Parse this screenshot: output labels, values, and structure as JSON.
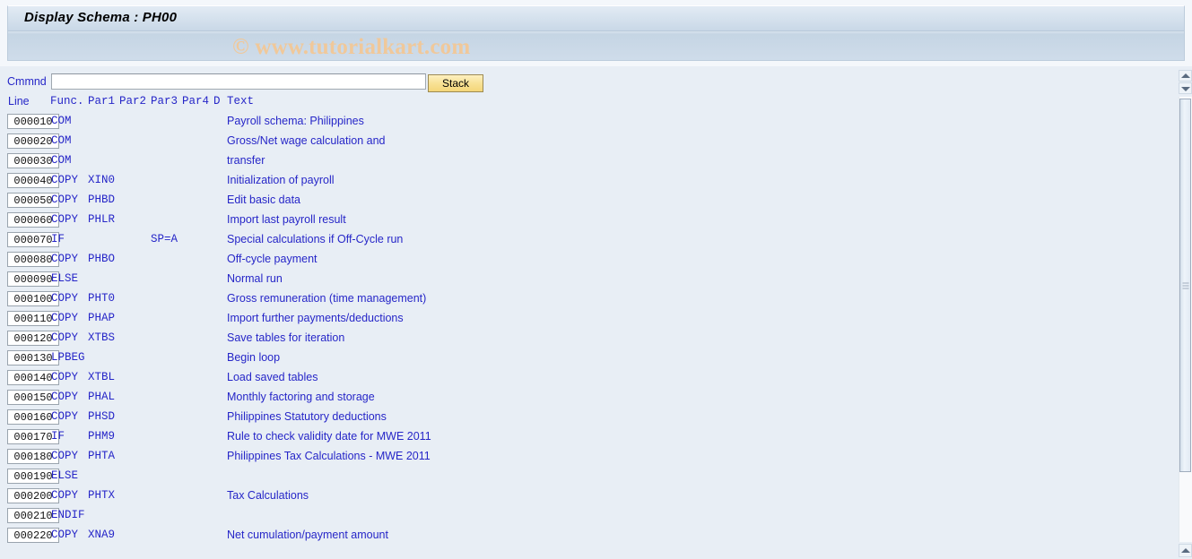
{
  "window": {
    "title": "Display Schema : PH00",
    "watermark": "© www.tutorialkart.com"
  },
  "command_bar": {
    "label": "Cmmnd",
    "value": "",
    "placeholder": "",
    "stack_label": "Stack"
  },
  "table": {
    "headers": {
      "line": "Line",
      "func": "Func.",
      "par1": "Par1",
      "par2": "Par2",
      "par3": "Par3",
      "par4": "Par4",
      "d": "D",
      "text": "Text"
    },
    "rows": [
      {
        "line": "000010",
        "func": "COM",
        "par1": "",
        "par2": "",
        "par3": "",
        "par4": "",
        "d": "",
        "text": "Payroll schema: Philippines"
      },
      {
        "line": "000020",
        "func": "COM",
        "par1": "",
        "par2": "",
        "par3": "",
        "par4": "",
        "d": "",
        "text": "Gross/Net wage calculation and"
      },
      {
        "line": "000030",
        "func": "COM",
        "par1": "",
        "par2": "",
        "par3": "",
        "par4": "",
        "d": "",
        "text": "transfer"
      },
      {
        "line": "000040",
        "func": "COPY",
        "par1": "XIN0",
        "par2": "",
        "par3": "",
        "par4": "",
        "d": "",
        "text": "Initialization of payroll"
      },
      {
        "line": "000050",
        "func": "COPY",
        "par1": "PHBD",
        "par2": "",
        "par3": "",
        "par4": "",
        "d": "",
        "text": "Edit basic data"
      },
      {
        "line": "000060",
        "func": "COPY",
        "par1": "PHLR",
        "par2": "",
        "par3": "",
        "par4": "",
        "d": "",
        "text": "Import last payroll result"
      },
      {
        "line": "000070",
        "func": "IF",
        "par1": "",
        "par2": "",
        "par3": "SP=A",
        "par4": "",
        "d": "",
        "text": "Special calculations if Off-Cycle run"
      },
      {
        "line": "000080",
        "func": "COPY",
        "par1": "PHBO",
        "par2": "",
        "par3": "",
        "par4": "",
        "d": "",
        "text": "Off-cycle payment"
      },
      {
        "line": "000090",
        "func": "ELSE",
        "par1": "",
        "par2": "",
        "par3": "",
        "par4": "",
        "d": "",
        "text": "Normal run"
      },
      {
        "line": "000100",
        "func": "COPY",
        "par1": "PHT0",
        "par2": "",
        "par3": "",
        "par4": "",
        "d": "",
        "text": "Gross remuneration (time management)"
      },
      {
        "line": "000110",
        "func": "COPY",
        "par1": "PHAP",
        "par2": "",
        "par3": "",
        "par4": "",
        "d": "",
        "text": "Import further payments/deductions"
      },
      {
        "line": "000120",
        "func": "COPY",
        "par1": "XTBS",
        "par2": "",
        "par3": "",
        "par4": "",
        "d": "",
        "text": "Save tables for iteration"
      },
      {
        "line": "000130",
        "func": "LPBEG",
        "par1": "",
        "par2": "",
        "par3": "",
        "par4": "",
        "d": "",
        "text": "Begin loop"
      },
      {
        "line": "000140",
        "func": "COPY",
        "par1": "XTBL",
        "par2": "",
        "par3": "",
        "par4": "",
        "d": "",
        "text": "Load saved tables"
      },
      {
        "line": "000150",
        "func": "COPY",
        "par1": "PHAL",
        "par2": "",
        "par3": "",
        "par4": "",
        "d": "",
        "text": "Monthly factoring and storage"
      },
      {
        "line": "000160",
        "func": "COPY",
        "par1": "PHSD",
        "par2": "",
        "par3": "",
        "par4": "",
        "d": "",
        "text": "Philippines Statutory deductions"
      },
      {
        "line": "000170",
        "func": "IF",
        "par1": "PHM9",
        "par2": "",
        "par3": "",
        "par4": "",
        "d": "",
        "text": "Rule to check validity date for MWE 2011"
      },
      {
        "line": "000180",
        "func": "COPY",
        "par1": "PHTA",
        "par2": "",
        "par3": "",
        "par4": "",
        "d": "",
        "text": "Philippines Tax Calculations - MWE 2011"
      },
      {
        "line": "000190",
        "func": "ELSE",
        "par1": "",
        "par2": "",
        "par3": "",
        "par4": "",
        "d": "",
        "text": ""
      },
      {
        "line": "000200",
        "func": "COPY",
        "par1": "PHTX",
        "par2": "",
        "par3": "",
        "par4": "",
        "d": "",
        "text": "Tax Calculations"
      },
      {
        "line": "000210",
        "func": "ENDIF",
        "par1": "",
        "par2": "",
        "par3": "",
        "par4": "",
        "d": "",
        "text": ""
      },
      {
        "line": "000220",
        "func": "COPY",
        "par1": "XNA9",
        "par2": "",
        "par3": "",
        "par4": "",
        "d": "",
        "text": "Net cumulation/payment amount"
      }
    ]
  },
  "scrollbars": {
    "top_up_icon": "triangle-up-icon",
    "top_down_icon": "triangle-down-icon",
    "bottom_up_icon": "triangle-up-icon"
  },
  "colors": {
    "text_blue": "#2626c8",
    "watermark": "#f0c89a",
    "button_gold": "#f4d679",
    "page_bg": "#e8eef5"
  }
}
